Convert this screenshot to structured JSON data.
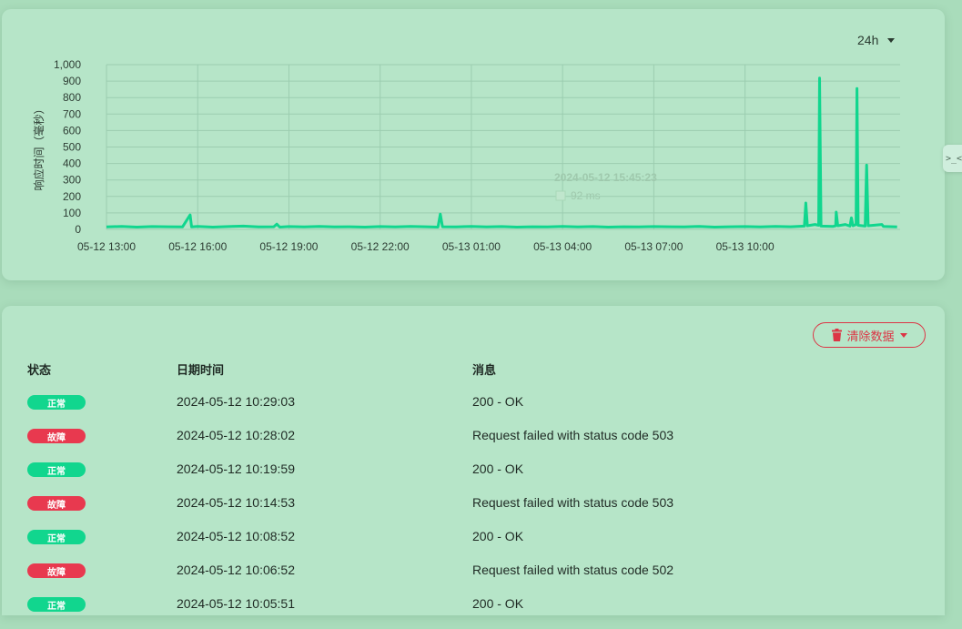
{
  "range_select": {
    "value": "24h"
  },
  "chart_data": {
    "type": "line",
    "ylabel": "响应时间（毫秒）",
    "ylim": [
      0,
      1000
    ],
    "y_ticks": [
      "0",
      "100",
      "200",
      "300",
      "400",
      "500",
      "600",
      "700",
      "800",
      "900",
      "1,000"
    ],
    "x_ticks": [
      "05-12 13:00",
      "05-12 16:00",
      "05-12 19:00",
      "05-12 22:00",
      "05-13 01:00",
      "05-13 04:00",
      "05-13 07:00",
      "05-13 10:00"
    ],
    "x_start_hour": 13,
    "x_end_hour": 39.1,
    "series_color": "#11d68e",
    "series": [
      {
        "points": [
          [
            13.0,
            15
          ],
          [
            13.5,
            18
          ],
          [
            14.0,
            14
          ],
          [
            14.5,
            17
          ],
          [
            15.0,
            16
          ],
          [
            15.5,
            15
          ],
          [
            15.75,
            88
          ],
          [
            15.8,
            15
          ],
          [
            16.0,
            18
          ],
          [
            16.5,
            14
          ],
          [
            17.0,
            17
          ],
          [
            17.5,
            20
          ],
          [
            18.0,
            15
          ],
          [
            18.5,
            16
          ],
          [
            18.6,
            32
          ],
          [
            18.7,
            14
          ],
          [
            19.0,
            17
          ],
          [
            19.5,
            15
          ],
          [
            20.0,
            18
          ],
          [
            20.5,
            15
          ],
          [
            21.0,
            16
          ],
          [
            21.5,
            14
          ],
          [
            22.0,
            17
          ],
          [
            22.5,
            15
          ],
          [
            23.0,
            18
          ],
          [
            23.5,
            16
          ],
          [
            23.9,
            14
          ],
          [
            23.98,
            93
          ],
          [
            24.05,
            16
          ],
          [
            24.5,
            15
          ],
          [
            25.0,
            18
          ],
          [
            25.5,
            15
          ],
          [
            26.0,
            17
          ],
          [
            26.5,
            14
          ],
          [
            27.0,
            16
          ],
          [
            27.5,
            15
          ],
          [
            28.0,
            18
          ],
          [
            28.5,
            15
          ],
          [
            29.0,
            17
          ],
          [
            29.5,
            14
          ],
          [
            30.0,
            16
          ],
          [
            30.5,
            15
          ],
          [
            31.0,
            17
          ],
          [
            31.5,
            16
          ],
          [
            32.0,
            15
          ],
          [
            32.5,
            18
          ],
          [
            33.0,
            14
          ],
          [
            33.5,
            16
          ],
          [
            34.0,
            17
          ],
          [
            34.5,
            15
          ],
          [
            35.0,
            18
          ],
          [
            35.5,
            16
          ],
          [
            35.95,
            20
          ],
          [
            36.0,
            160
          ],
          [
            36.05,
            22
          ],
          [
            36.3,
            30
          ],
          [
            36.42,
            25
          ],
          [
            36.45,
            918
          ],
          [
            36.5,
            20
          ],
          [
            36.9,
            18
          ],
          [
            36.98,
            22
          ],
          [
            37.0,
            105
          ],
          [
            37.05,
            22
          ],
          [
            37.3,
            30
          ],
          [
            37.45,
            20
          ],
          [
            37.5,
            70
          ],
          [
            37.55,
            22
          ],
          [
            37.65,
            30
          ],
          [
            37.68,
            855
          ],
          [
            37.72,
            25
          ],
          [
            37.95,
            20
          ],
          [
            38.0,
            390
          ],
          [
            38.05,
            22
          ],
          [
            38.5,
            30
          ],
          [
            38.55,
            18
          ],
          [
            39.0,
            15
          ]
        ]
      }
    ]
  },
  "tooltip": {
    "title": "2024-05-12 15:45:23",
    "value": "92 ms"
  },
  "side_handle": {
    "glyph": ">_<"
  },
  "clear_button": {
    "label": "清除数据"
  },
  "table": {
    "headers": {
      "status": "状态",
      "date": "日期时间",
      "message": "消息"
    },
    "rows": [
      {
        "status": "正常",
        "status_type": "up",
        "date": "2024-05-12 10:29:03",
        "message": "200 - OK"
      },
      {
        "status": "故障",
        "status_type": "down",
        "date": "2024-05-12 10:28:02",
        "message": "Request failed with status code 503"
      },
      {
        "status": "正常",
        "status_type": "up",
        "date": "2024-05-12 10:19:59",
        "message": "200 - OK"
      },
      {
        "status": "故障",
        "status_type": "down",
        "date": "2024-05-12 10:14:53",
        "message": "Request failed with status code 503"
      },
      {
        "status": "正常",
        "status_type": "up",
        "date": "2024-05-12 10:08:52",
        "message": "200 - OK"
      },
      {
        "status": "故障",
        "status_type": "down",
        "date": "2024-05-12 10:06:52",
        "message": "Request failed with status code 502"
      },
      {
        "status": "正常",
        "status_type": "up",
        "date": "2024-05-12 10:05:51",
        "message": "200 - OK"
      }
    ]
  }
}
